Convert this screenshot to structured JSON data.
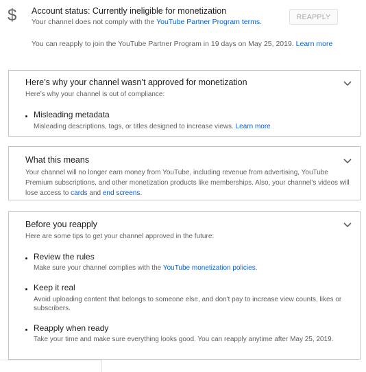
{
  "status": {
    "icon": "dollar-icon",
    "title": "Account status: Currently ineligible for monetization",
    "sub_prefix": "Your channel does not comply with the ",
    "sub_link": "YouTube Partner Program terms",
    "sub_suffix": ".",
    "reapply_button": "REAPPLY",
    "note": "You can reapply to join the YouTube Partner Program in 19 days on May 25, 2019.",
    "note_link": "Learn more"
  },
  "why": {
    "title": "Here’s why your channel wasn’t approved for monetization",
    "subtitle": "Here’s why your channel is out of compliance:",
    "item_title": "Misleading metadata",
    "item_desc": "Misleading descriptions, tags, or titles designed to increase views.",
    "item_link": "Learn more"
  },
  "means": {
    "title": "What this means",
    "text_1": "Your channel will no longer earn money from YouTube, including revenue from advertising, YouTube Premium subscriptions, and other monetization products like memberships. Also, your channel's videos will lose access to ",
    "link_1": "cards",
    "text_2": " and ",
    "link_2": "end screens",
    "text_3": "."
  },
  "before": {
    "title": "Before you reapply",
    "subtitle": "Here are some tips to get your channel approved in the future:",
    "items": [
      {
        "title": "Review the rules",
        "desc_prefix": "Make sure your channel complies with the ",
        "desc_link": "YouTube monetization policies",
        "desc_suffix": "."
      },
      {
        "title": "Keep it real",
        "desc": "Avoid uploading content that belongs to someone else, and don't pay to increase view counts, likes or subscribers."
      },
      {
        "title": "Reapply when ready",
        "desc": "Take your time and make sure everything looks good. You can reapply anytime after May 25, 2019."
      }
    ]
  },
  "colors": {
    "link": "#065fd4",
    "border": "#c4c4c4",
    "secondary_text": "#606060"
  }
}
